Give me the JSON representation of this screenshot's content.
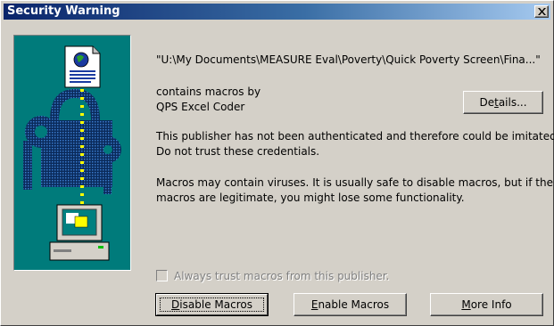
{
  "window": {
    "title": "Security Warning",
    "close_label": "×"
  },
  "message": {
    "file_path": "\"U:\\My Documents\\MEASURE Eval\\Poverty\\Quick Poverty Screen\\Fina...\"",
    "contains_macros_by": "contains macros by",
    "publisher": "QPS Excel Coder",
    "auth_line1": "This publisher has not been authenticated and therefore could be imitated.",
    "auth_line2": "Do not trust these credentials.",
    "virus_line1": "Macros may contain viruses. It is usually safe to disable macros, but if the",
    "virus_line2": "macros are legitimate, you might lose some functionality."
  },
  "buttons": {
    "details": {
      "pre": "De",
      "accel": "t",
      "post": "ails..."
    },
    "disable": {
      "pre": "",
      "accel": "D",
      "post": "isable Macros"
    },
    "enable": {
      "pre": "",
      "accel": "E",
      "post": "nable Macros"
    },
    "more_info": {
      "pre": "",
      "accel": "M",
      "post": "ore Info"
    }
  },
  "checkbox": {
    "label": "Always trust macros from this publisher.",
    "checked": false,
    "enabled": false
  },
  "colors": {
    "title_gradient_start": "#0a246a",
    "title_gradient_end": "#a6caf0",
    "panel_teal": "#007b7b",
    "face": "#d4d0c8"
  },
  "icons": [
    "document-globe-icon",
    "padlock-keys-icon",
    "computer-icon",
    "close-icon"
  ]
}
